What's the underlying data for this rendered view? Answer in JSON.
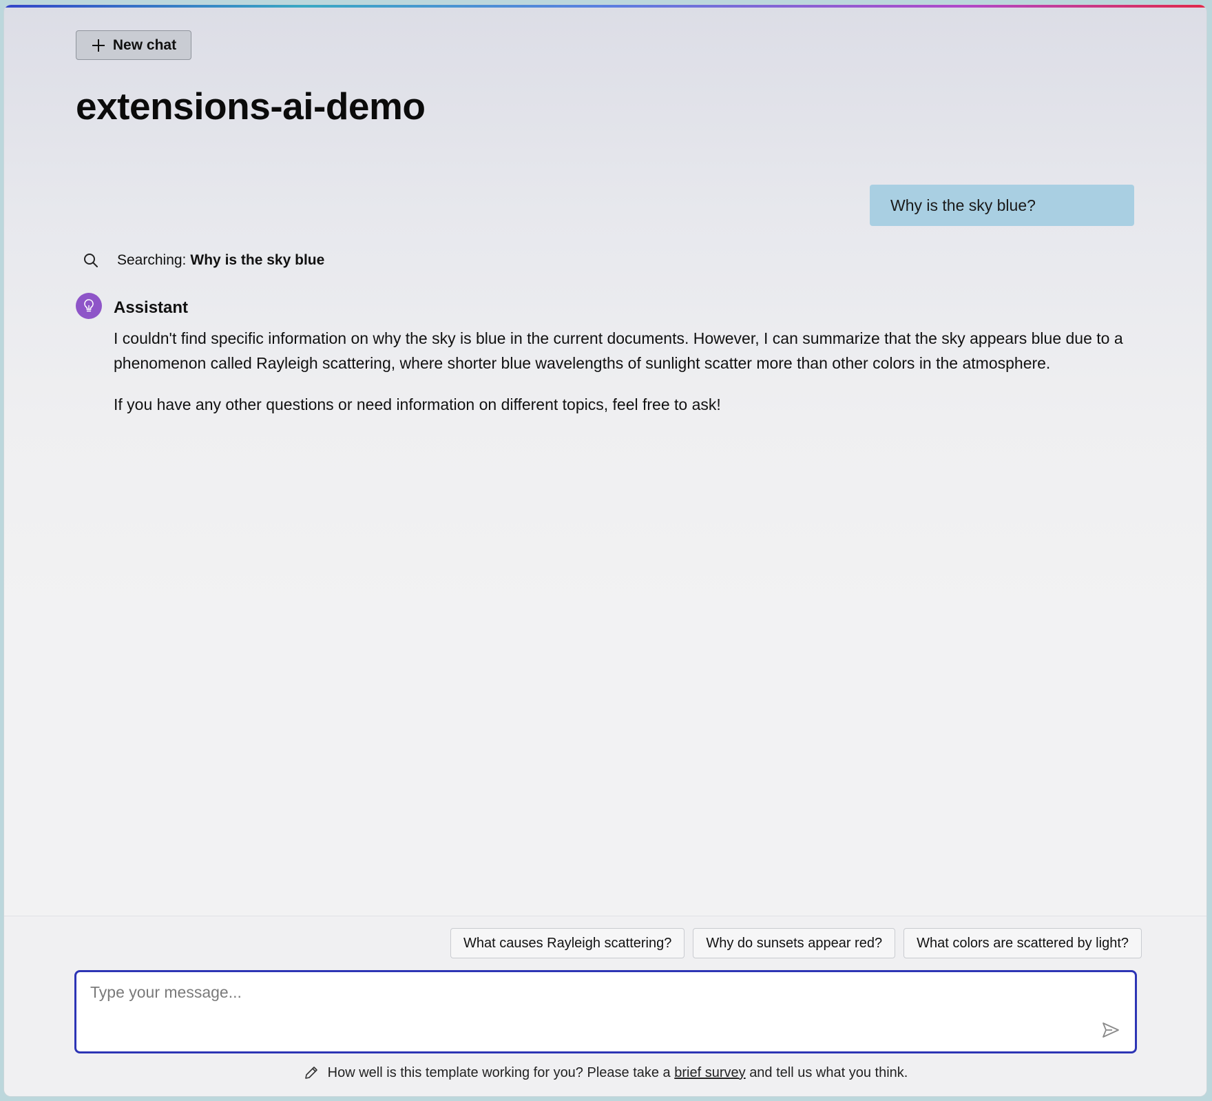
{
  "app": {
    "title": "extensions-ai-demo"
  },
  "header": {
    "new_chat_label": "New chat",
    "new_chat_icon": "plus-icon"
  },
  "conversation": {
    "user_message": "Why is the sky blue?",
    "search_status": {
      "prefix": "Searching:",
      "query": "Why is the sky blue",
      "icon": "search-icon"
    },
    "assistant": {
      "name": "Assistant",
      "avatar_icon": "lightbulb-icon",
      "avatar_color": "#8e55c8",
      "paragraphs": [
        "I couldn't find specific information on why the sky is blue in the current documents. However, I can summarize that the sky appears blue due to a phenomenon called Rayleigh scattering, where shorter blue wavelengths of sunlight scatter more than other colors in the atmosphere.",
        "If you have any other questions or need information on different topics, feel free to ask!"
      ]
    }
  },
  "suggestions": [
    "What causes Rayleigh scattering?",
    "Why do sunsets appear red?",
    "What colors are scattered by light?"
  ],
  "composer": {
    "placeholder": "Type your message...",
    "value": "",
    "send_icon": "send-icon",
    "border_color": "#2d35b5"
  },
  "footer": {
    "before_link": "How well is this template working for you? Please take a",
    "link_text": "brief survey",
    "after_link": "and tell us what you think.",
    "icon": "pencil-icon"
  },
  "colors": {
    "user_bubble": "#a9cfe2",
    "accent": "#2d35b5"
  }
}
